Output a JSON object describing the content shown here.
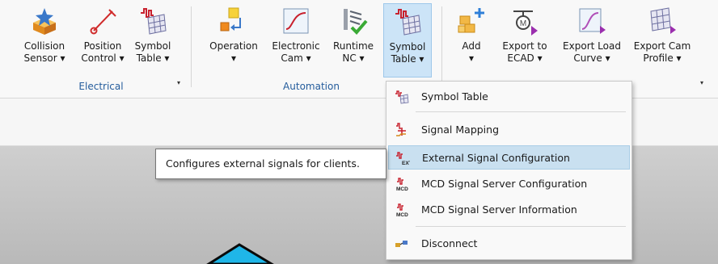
{
  "ribbon": {
    "groups": {
      "electrical": "Electrical",
      "automation": "Automation"
    },
    "group_arrow": "▾",
    "buttons": {
      "collision_sensor": {
        "line1": "Collision",
        "line2": "Sensor ▾"
      },
      "position_control": {
        "line1": "Position",
        "line2": "Control ▾"
      },
      "symbol_table_e": {
        "line1": "Symbol",
        "line2": "Table ▾"
      },
      "operation": {
        "line1": "Operation",
        "line2": "▾"
      },
      "electronic_cam": {
        "line1": "Electronic",
        "line2": "Cam ▾"
      },
      "runtime_nc": {
        "line1": "Runtime",
        "line2": "NC ▾"
      },
      "symbol_table_a": {
        "line1": "Symbol",
        "line2": "Table ▾"
      },
      "add": {
        "line1": "Add",
        "line2": "▾"
      },
      "export_ecad": {
        "line1": "Export to",
        "line2": "ECAD ▾"
      },
      "export_load_curve": {
        "line1": "Export Load",
        "line2": "Curve ▾"
      },
      "export_cam_profile": {
        "line1": "Export Cam",
        "line2": "Profile ▾"
      }
    }
  },
  "menu": {
    "items": [
      {
        "label": "Symbol Table",
        "icon": "symbol-table-icon"
      },
      {
        "label": "Signal Mapping",
        "icon": "signal-mapping-icon"
      },
      {
        "label": "External Signal Configuration",
        "icon": "ext-signal-icon",
        "highlighted": true
      },
      {
        "label": "MCD Signal Server Configuration",
        "icon": "mcd-signal-icon"
      },
      {
        "label": "MCD Signal Server Information",
        "icon": "mcd-signal-icon"
      },
      {
        "label": "Disconnect",
        "icon": "disconnect-icon"
      }
    ]
  },
  "tooltip": {
    "text": "Configures external signals for clients."
  },
  "colors": {
    "accent_blue": "#245c9c",
    "hover": "#c9e0f0",
    "active_button": "#cce4f7",
    "canvas_shape": "#1fb6e8"
  }
}
